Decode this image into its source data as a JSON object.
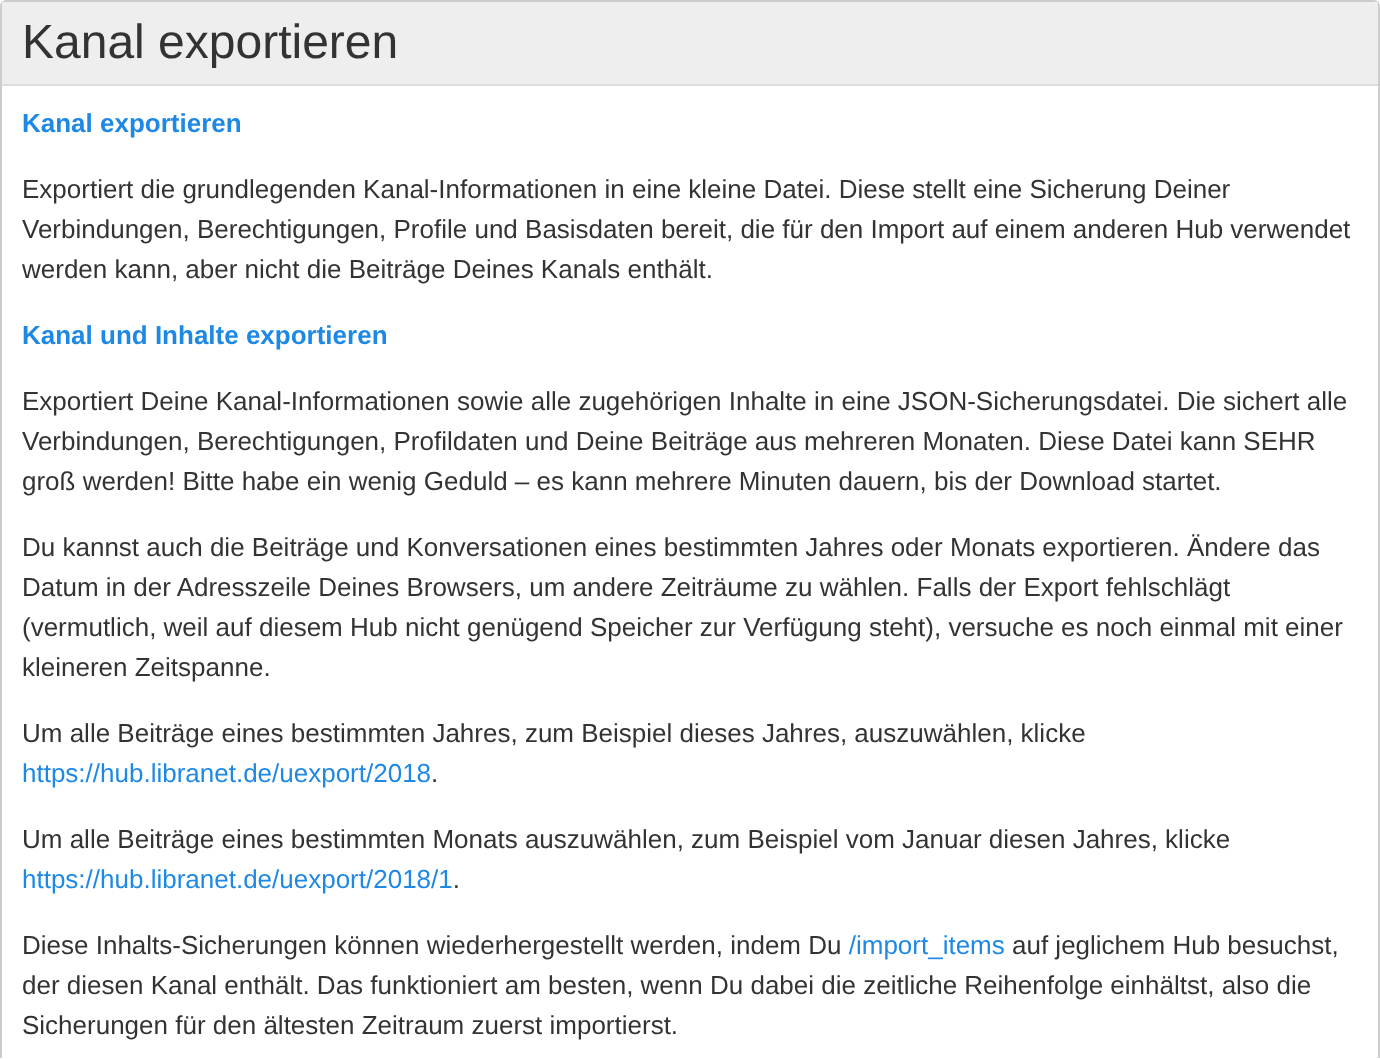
{
  "panel": {
    "title": "Kanal exportieren"
  },
  "blocks": [
    {
      "kind": "heading",
      "parts": [
        {
          "kind": "link",
          "text": "Kanal exportieren"
        }
      ]
    },
    {
      "kind": "paragraph",
      "parts": [
        {
          "kind": "text",
          "text": "Exportiert die grundlegenden Kanal-Informationen in eine kleine Datei. Diese stellt eine Sicherung Deiner Verbindungen, Berechtigungen, Profile und Basisdaten bereit, die für den Import auf einem anderen Hub verwendet werden kann, aber nicht die Beiträge Deines Kanals enthält."
        }
      ]
    },
    {
      "kind": "heading",
      "parts": [
        {
          "kind": "link",
          "text": "Kanal und Inhalte exportieren"
        }
      ]
    },
    {
      "kind": "paragraph",
      "parts": [
        {
          "kind": "text",
          "text": "Exportiert Deine Kanal-Informationen sowie alle zugehörigen Inhalte in eine JSON-Sicherungsdatei. Die sichert alle Verbindungen, Berechtigungen, Profildaten und Deine Beiträge aus mehreren Monaten. Diese Datei kann SEHR groß werden! Bitte habe ein wenig Geduld – es kann mehrere Minuten dauern, bis der Download startet."
        }
      ]
    },
    {
      "kind": "paragraph",
      "parts": [
        {
          "kind": "text",
          "text": "Du kannst auch die Beiträge und Konversationen eines bestimmten Jahres oder Monats exportieren. Ändere das Datum in der Adresszeile Deines Browsers, um andere Zeiträume zu wählen. Falls der Export fehlschlägt (vermutlich, weil auf diesem Hub nicht genügend Speicher zur Verfügung steht), versuche es noch einmal mit einer kleineren Zeitspanne."
        }
      ]
    },
    {
      "kind": "paragraph",
      "parts": [
        {
          "kind": "text",
          "text": "Um alle Beiträge eines bestimmten Jahres, zum Beispiel dieses Jahres, auszuwählen, klicke "
        },
        {
          "kind": "link",
          "text": "https://hub.libranet.de/uexport/2018"
        },
        {
          "kind": "text",
          "text": "."
        }
      ]
    },
    {
      "kind": "paragraph",
      "parts": [
        {
          "kind": "text",
          "text": "Um alle Beiträge eines bestimmten Monats auszuwählen, zum Beispiel vom Januar diesen Jahres, klicke "
        },
        {
          "kind": "link",
          "text": "https://hub.libranet.de/uexport/2018/1"
        },
        {
          "kind": "text",
          "text": "."
        }
      ]
    },
    {
      "kind": "paragraph",
      "parts": [
        {
          "kind": "text",
          "text": "Diese Inhalts-Sicherungen können wiederhergestellt werden, indem Du "
        },
        {
          "kind": "link",
          "text": "/import_items"
        },
        {
          "kind": "text",
          "text": " auf jeglichem Hub besuchst, der diesen Kanal enthält. Das funktioniert am besten, wenn Du dabei die zeitliche Reihenfolge einhältst, also die Sicherungen für den ältesten Zeitraum zuerst importierst."
        }
      ]
    }
  ]
}
